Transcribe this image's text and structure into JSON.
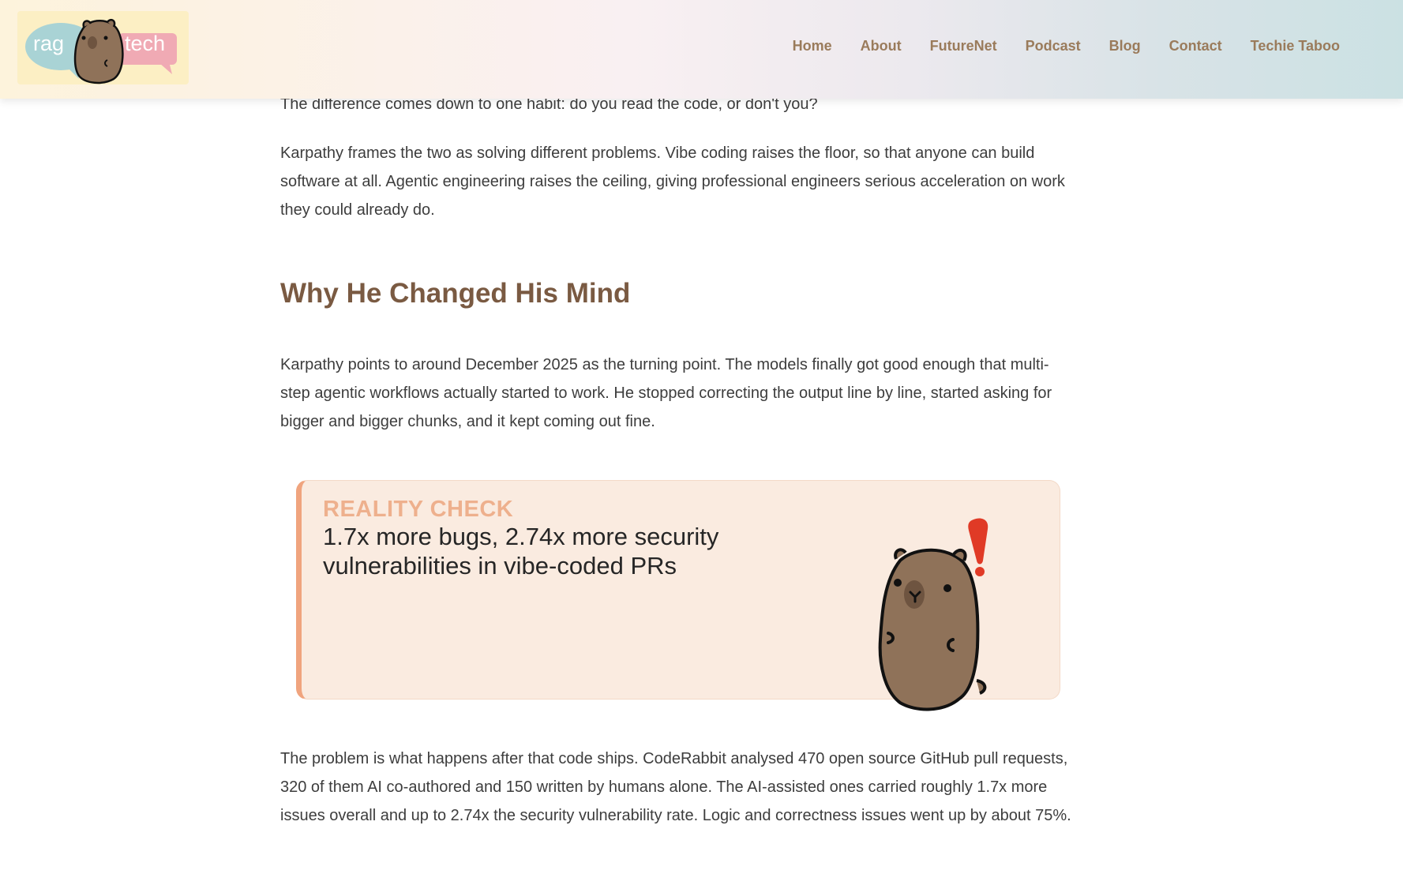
{
  "header": {
    "logo": {
      "left_text": "rag",
      "right_text": "tech"
    },
    "nav": [
      {
        "label": "Home"
      },
      {
        "label": "About"
      },
      {
        "label": "FutureNet"
      },
      {
        "label": "Podcast"
      },
      {
        "label": "Blog"
      },
      {
        "label": "Contact"
      },
      {
        "label": "Techie Taboo"
      }
    ]
  },
  "article": {
    "paragraph_0": "The difference comes down to one habit: do you read the code, or don't you?",
    "paragraph_1": "Karpathy frames the two as solving different problems. Vibe coding raises the floor, so that anyone can build software at all. Agentic engineering raises the ceiling, giving professional engineers serious acceleration on work they could already do.",
    "heading": "Why He Changed His Mind",
    "paragraph_2": "Karpathy points to around December 2025 as the turning point. The models finally got good enough that multi-step agentic workflows actually started to work. He stopped correcting the output line by line, started asking for bigger and bigger chunks, and it kept coming out fine.",
    "callout": {
      "kicker": "REALITY CHECK",
      "text": "1.7x more bugs, 2.74x more security vulnerabilities in vibe-coded PRs"
    },
    "paragraph_3": "The problem is what happens after that code ships. CodeRabbit analysed 470 open source GitHub pull requests, 320 of them AI co-authored and 150 written by humans alone. The AI-assisted ones carried roughly 1.7x more issues overall and up to 2.74x the security vulnerability rate. Logic and correctness issues went up by about 75%."
  },
  "colors": {
    "nav_text": "#9a7b5b",
    "heading": "#7a5a42",
    "callout_bg": "#faebe0",
    "callout_accent": "#f0a47e",
    "callout_kicker": "#eeb08d",
    "capybara": "#8f7259",
    "alert_red": "#e03a26"
  },
  "icons": {
    "logo_mascot": "capybara-logo-icon",
    "callout_mascot": "capybara-alert-icon"
  }
}
